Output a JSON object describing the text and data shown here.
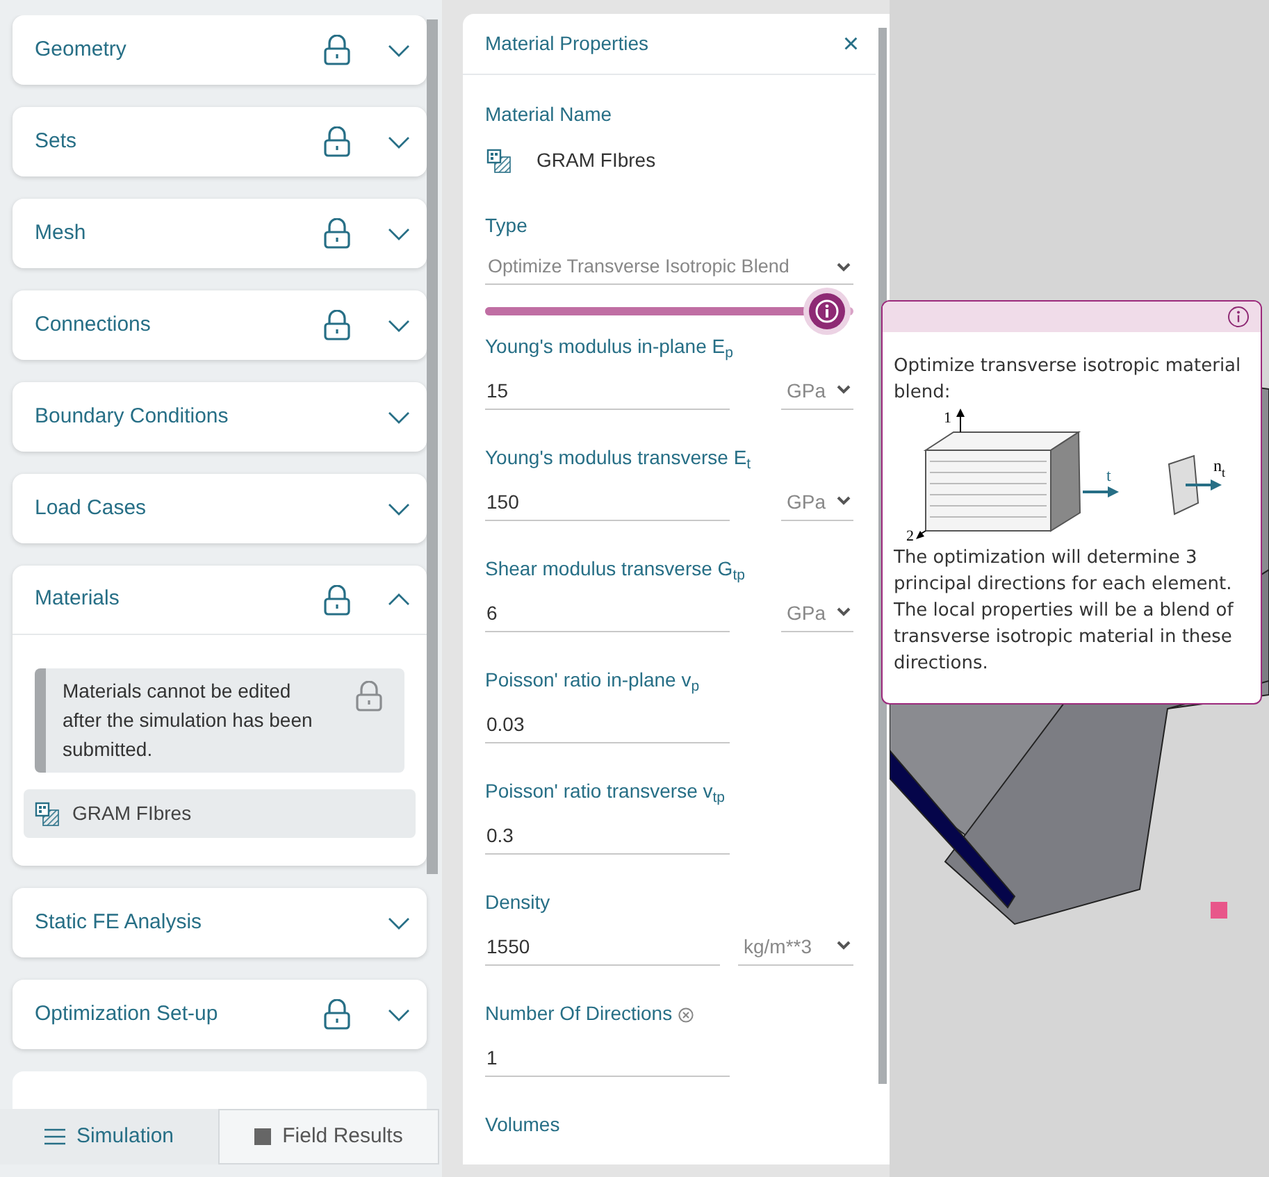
{
  "sidebar": {
    "sections": [
      {
        "title": "Geometry",
        "locked": true,
        "expanded": false
      },
      {
        "title": "Sets",
        "locked": true,
        "expanded": false
      },
      {
        "title": "Mesh",
        "locked": true,
        "expanded": false
      },
      {
        "title": "Connections",
        "locked": true,
        "expanded": false
      },
      {
        "title": "Boundary Conditions",
        "locked": false,
        "expanded": false
      },
      {
        "title": "Load Cases",
        "locked": false,
        "expanded": false
      },
      {
        "title": "Materials",
        "locked": true,
        "expanded": true,
        "notice": "Materials cannot be edited after the simulation has been submitted.",
        "items": [
          "GRAM FIbres"
        ]
      },
      {
        "title": "Static FE Analysis",
        "locked": false,
        "expanded": false
      },
      {
        "title": "Optimization Set-up",
        "locked": true,
        "expanded": false
      }
    ],
    "tabs": [
      {
        "label": "Simulation",
        "selected": true
      },
      {
        "label": "Field Results",
        "selected": false
      }
    ]
  },
  "material_panel": {
    "title": "Material Properties",
    "close": "×",
    "name_label": "Material Name",
    "name": "GRAM FIbres",
    "type_label": "Type",
    "type_value": "Optimize Transverse Isotropic Blend",
    "slider": {
      "level": 0.93
    },
    "fields": [
      {
        "label": "Young's modulus in-plane E$_{p}$",
        "value": "15",
        "unit": "GPa",
        "help_icon": false
      },
      {
        "label": "Young's modulus transverse E$_{t}$",
        "value": "150",
        "unit": "GPa",
        "help_icon": false
      },
      {
        "label": "Shear modulus transverse G$_{tp}$",
        "value": "6",
        "unit": "GPa",
        "help_icon": false
      },
      {
        "label": "Poisson' ratio in-plane v$_{p}$",
        "value": "0.03",
        "help_icon": false
      },
      {
        "label": "Poisson' ratio transverse v$_{tp}$",
        "value": "0.3",
        "help_icon": false
      },
      {
        "label": "Density",
        "value": "1550",
        "unit": "kg/m**3",
        "help_icon": false
      },
      {
        "label": "Number Of Directions",
        "value": "1",
        "help_icon": true
      }
    ],
    "volumes_label": "Volumes"
  },
  "tooltip": {
    "heading": "Optimize transverse isotropic material blend:",
    "diagram_labels": {
      "axis_1": "1",
      "axis_2": "2",
      "axis_t": "t",
      "normal": "n",
      "normal_sub": "t"
    },
    "body": "The optimization will determine 3 principal directions for each element. The local properties will be a blend of transverse isotropic material in these directions."
  }
}
